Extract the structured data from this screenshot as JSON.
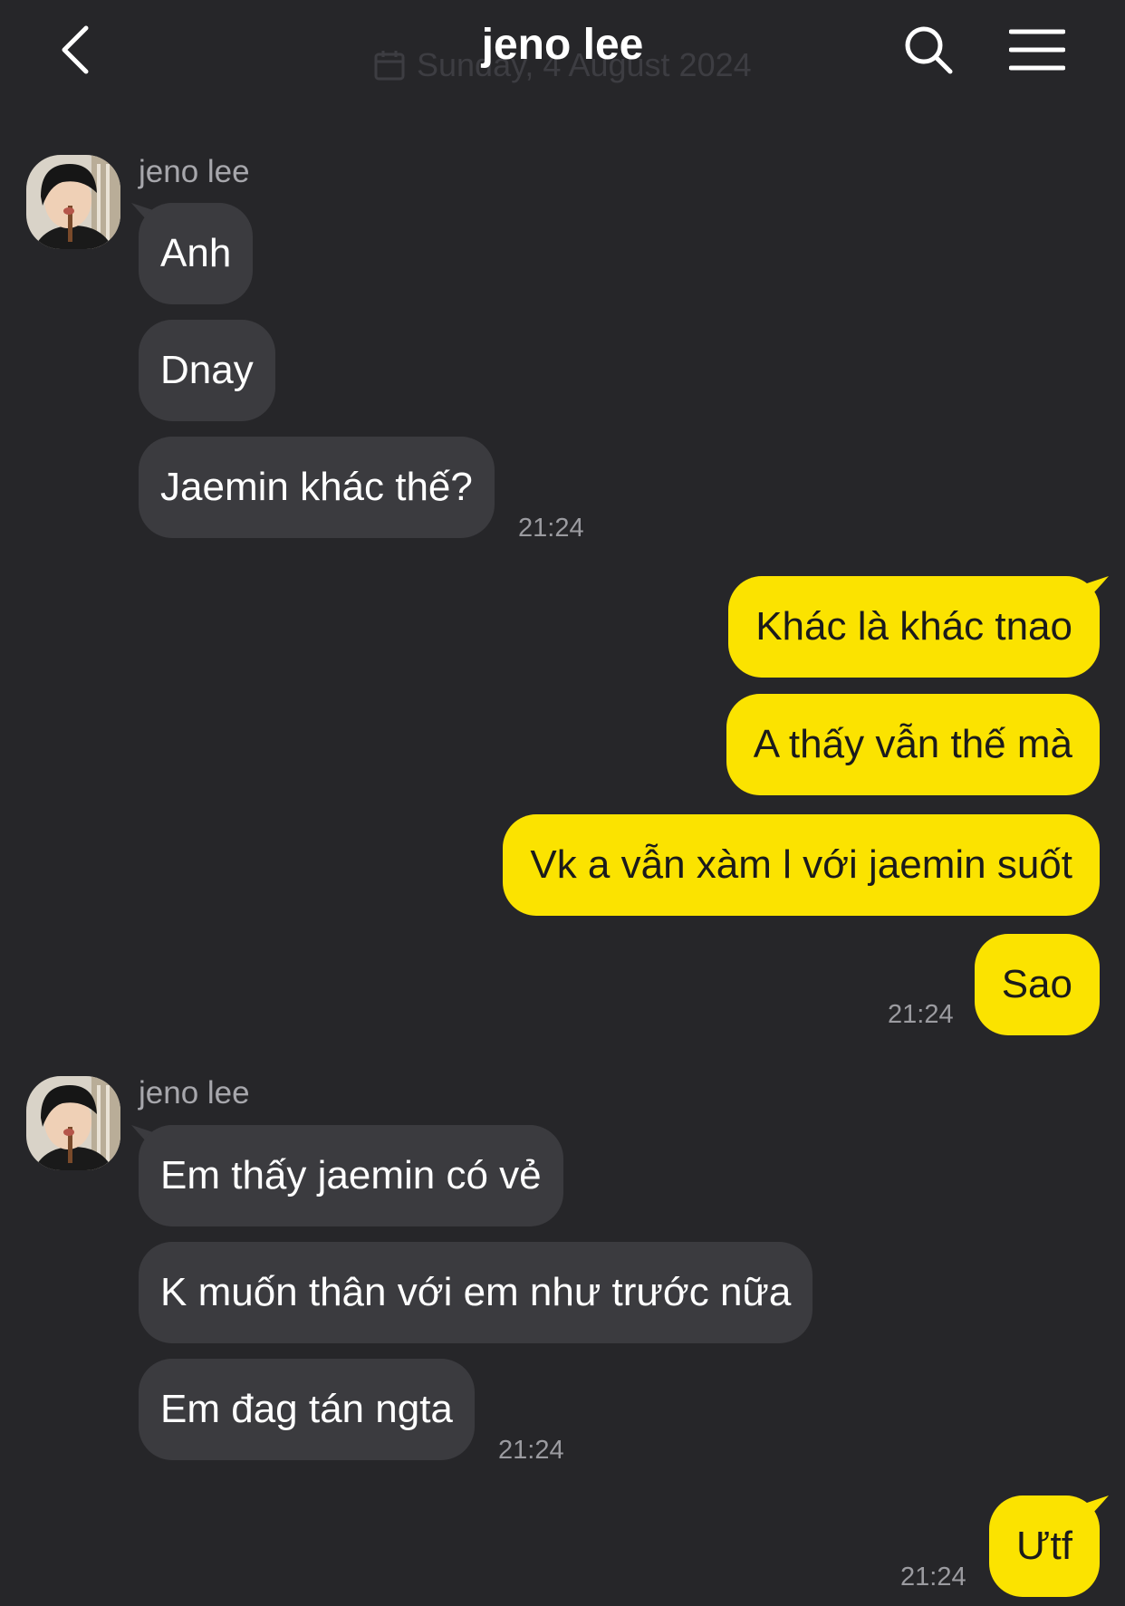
{
  "header": {
    "title": "jeno lee",
    "date_watermark": "Sunday, 4 August 2024",
    "icons": {
      "back": "chevron-left-icon",
      "search": "search-icon",
      "menu": "hamburger-menu-icon"
    }
  },
  "colors": {
    "background": "#262629",
    "incoming_bubble": "#3b3b3f",
    "outgoing_bubble": "#fbe300",
    "timestamp": "#9b9ba0"
  },
  "messages": {
    "group1": {
      "sender": "jeno lee",
      "items": [
        "Anh",
        "Dnay",
        "Jaemin khác thế?"
      ],
      "time": "21:24"
    },
    "group2": {
      "items": [
        "Khác là khác tnao",
        "A thấy vẫn thế mà",
        "Vk a vẫn xàm l với jaemin suốt",
        "Sao"
      ],
      "time": "21:24"
    },
    "group3": {
      "sender": "jeno lee",
      "items": [
        "Em thấy jaemin có vẻ",
        "K muốn thân với em như trước nữa",
        "Em đag tán ngta"
      ],
      "time": "21:24"
    },
    "group4": {
      "items": [
        "Ưtf"
      ],
      "time": "21:24"
    }
  }
}
